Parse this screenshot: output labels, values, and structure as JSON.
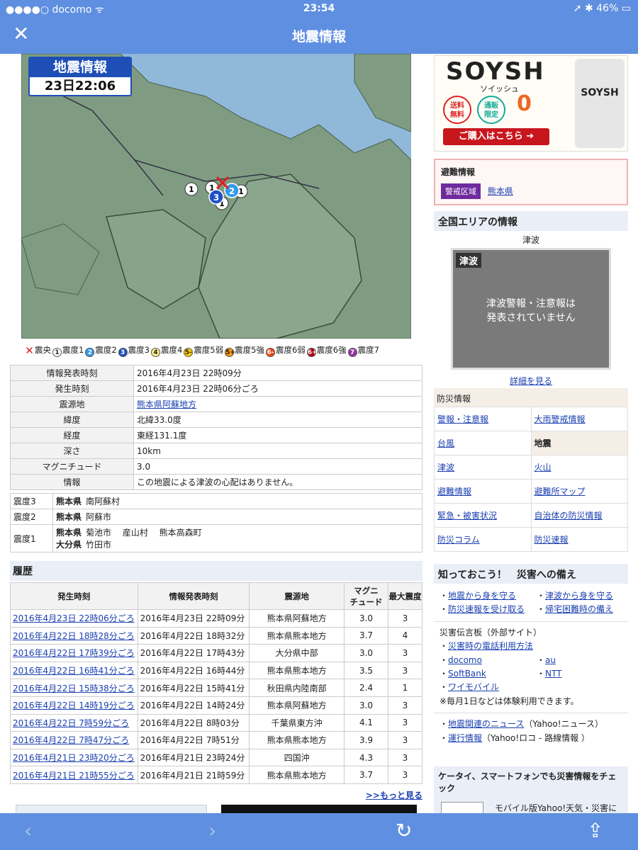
{
  "status": {
    "left": "●●●●○ docomo ᯤ",
    "time": "23:54",
    "right": "➚ ✱ 46% ▭"
  },
  "nav": {
    "close": "✕",
    "title": "地震情報"
  },
  "map": {
    "badge_title": "地震情報",
    "badge_date": "23日22:06"
  },
  "legend": [
    {
      "icon": "✕",
      "label": "震央",
      "color": "#e02020"
    },
    {
      "icon": "1",
      "label": "震度1",
      "color": "#ffffff"
    },
    {
      "icon": "2",
      "label": "震度2",
      "color": "#3399ee"
    },
    {
      "icon": "3",
      "label": "震度3",
      "color": "#1f4fc8"
    },
    {
      "icon": "4",
      "label": "震度4",
      "color": "#ffee88"
    },
    {
      "icon": "5-",
      "label": "震度5弱",
      "color": "#ffd000"
    },
    {
      "icon": "5+",
      "label": "震度5強",
      "color": "#ff9900"
    },
    {
      "icon": "6-",
      "label": "震度6弱",
      "color": "#ee4411"
    },
    {
      "icon": "6+",
      "label": "震度6強",
      "color": "#aa0010"
    },
    {
      "icon": "7",
      "label": "震度7",
      "color": "#9933aa"
    }
  ],
  "info": [
    {
      "k": "情報発表時刻",
      "v": "2016年4月23日 22時09分",
      "link": false
    },
    {
      "k": "発生時刻",
      "v": "2016年4月23日 22時06分ごろ",
      "link": false
    },
    {
      "k": "震源地",
      "v": "熊本県阿蘇地方",
      "link": true
    },
    {
      "k": "緯度",
      "v": "北緯33.0度",
      "link": false
    },
    {
      "k": "経度",
      "v": "東経131.1度",
      "link": false
    },
    {
      "k": "深さ",
      "v": "10km",
      "link": false
    },
    {
      "k": "マグニチュード",
      "v": "3.0",
      "link": false
    },
    {
      "k": "情報",
      "v": "この地震による津波の心配はありません。",
      "link": false
    }
  ],
  "shindo": [
    {
      "k": "震度3",
      "rows": [
        {
          "pref": "熊本県",
          "places": "南阿蘇村"
        }
      ]
    },
    {
      "k": "震度2",
      "rows": [
        {
          "pref": "熊本県",
          "places": "阿蘇市"
        }
      ]
    },
    {
      "k": "震度1",
      "rows": [
        {
          "pref": "熊本県",
          "places": "菊池市　 産山村　 熊本高森町"
        },
        {
          "pref": "大分県",
          "places": "竹田市"
        }
      ]
    }
  ],
  "history": {
    "title": "履歴",
    "headers": [
      "発生時刻",
      "情報発表時刻",
      "震源地",
      "マグニ\nチュード",
      "最大震度"
    ],
    "rows": [
      [
        "2016年4月23日 22時06分ごろ",
        "2016年4月23日 22時09分",
        "熊本県阿蘇地方",
        "3.0",
        "3"
      ],
      [
        "2016年4月22日 18時28分ごろ",
        "2016年4月22日 18時32分",
        "熊本県熊本地方",
        "3.7",
        "4"
      ],
      [
        "2016年4月22日 17時39分ごろ",
        "2016年4月22日 17時43分",
        "大分県中部",
        "3.0",
        "3"
      ],
      [
        "2016年4月22日 16時41分ごろ",
        "2016年4月22日 16時44分",
        "熊本県熊本地方",
        "3.5",
        "3"
      ],
      [
        "2016年4月22日 15時38分ごろ",
        "2016年4月22日 15時41分",
        "秋田県内陸南部",
        "2.4",
        "1"
      ],
      [
        "2016年4月22日 14時19分ごろ",
        "2016年4月22日 14時24分",
        "熊本県阿蘇地方",
        "3.0",
        "3"
      ],
      [
        "2016年4月22日 7時59分ごろ",
        "2016年4月22日 8時03分",
        "千葉県東方沖",
        "4.1",
        "3"
      ],
      [
        "2016年4月22日 7時47分ごろ",
        "2016年4月22日 7時51分",
        "熊本県熊本地方",
        "3.9",
        "3"
      ],
      [
        "2016年4月21日 23時20分ごろ",
        "2016年4月21日 23時24分",
        "四国沖",
        "4.3",
        "3"
      ],
      [
        "2016年4月21日 21時55分ごろ",
        "2016年4月21日 21時59分",
        "熊本県熊本地方",
        "3.7",
        "3"
      ]
    ],
    "more": ">>もっと見る"
  },
  "ad": {
    "brand": "SOYSH",
    "sub": "ソイッシュ",
    "badge1": "送料\n無料",
    "badge2": "通販\n限定",
    "zero": "0",
    "buy": "ご購入はこちら ➔",
    "can": "SOYSH"
  },
  "evac": {
    "title": "避難情報",
    "tag": "警戒区域",
    "pref": "熊本県"
  },
  "area": {
    "title": "全国エリアの情報",
    "tsunami_label": "津波",
    "tsunami_img_label": "津波",
    "tsunami_msg": "津波警報・注意報は\n発表されていません",
    "detail": "詳細を見る"
  },
  "bousai": {
    "title": "防災情報",
    "cells": [
      [
        "警報・注意報",
        "大雨警戒情報"
      ],
      [
        "台風",
        "地震"
      ],
      [
        "津波",
        "火山"
      ],
      [
        "避難情報",
        "避難所マップ"
      ],
      [
        "緊急・被害状況",
        "自治体の防災情報"
      ],
      [
        "防災コラム",
        "防災速報"
      ]
    ]
  },
  "sonae": {
    "title": "知っておこう！　災害への備え",
    "links": [
      [
        "地震から身を守る",
        "津波から身を守る"
      ],
      [
        "防災速報を受け取る",
        "帰宅困難時の備え"
      ]
    ],
    "board_title": "災害伝言板（外部サイト）",
    "board_links": [
      "災害時の電話利用方法"
    ],
    "carriers": [
      [
        "docomo",
        "au"
      ],
      [
        "SoftBank",
        "NTT"
      ],
      [
        "ワイモバイル",
        ""
      ]
    ],
    "note": "※毎月1日などは体験利用できます。",
    "news": "地震関連のニュース",
    "news_src": "（Yahoo!ニュース）",
    "train": "運行情報",
    "train_src": "（Yahoo!ロコ - 路線情報 ）"
  },
  "keitai": {
    "title": "ケータイ、スマートフォンでも災害情報をチェック",
    "text": "モバイル版Yahoo!天気・災害に"
  },
  "toolbar": {
    "back": "‹",
    "forward": "›",
    "reload": "↻",
    "share": "⇪"
  }
}
